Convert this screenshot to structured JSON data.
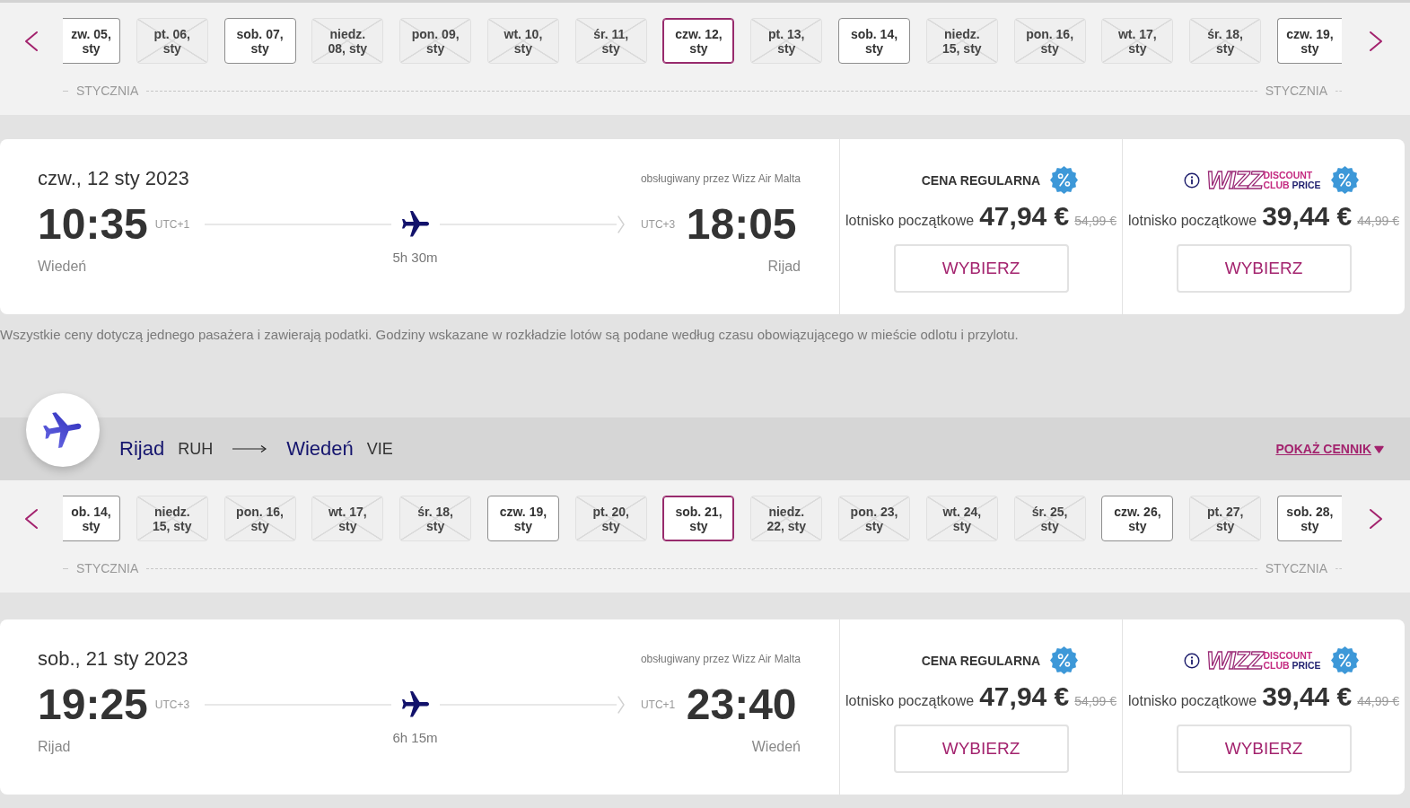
{
  "outbound": {
    "date_strip": {
      "dates": [
        {
          "label": "zw. 05, sty",
          "available": true,
          "selected": false
        },
        {
          "label": "pt. 06, sty",
          "available": false,
          "selected": false
        },
        {
          "label": "sob. 07, sty",
          "available": true,
          "selected": false
        },
        {
          "label": "niedz. 08, sty",
          "available": false,
          "selected": false
        },
        {
          "label": "pon. 09, sty",
          "available": false,
          "selected": false
        },
        {
          "label": "wt. 10, sty",
          "available": false,
          "selected": false
        },
        {
          "label": "śr. 11, sty",
          "available": false,
          "selected": false
        },
        {
          "label": "czw. 12, sty",
          "available": true,
          "selected": true
        },
        {
          "label": "pt. 13, sty",
          "available": false,
          "selected": false
        },
        {
          "label": "sob. 14, sty",
          "available": true,
          "selected": false
        },
        {
          "label": "niedz. 15, sty",
          "available": false,
          "selected": false
        },
        {
          "label": "pon. 16, sty",
          "available": false,
          "selected": false
        },
        {
          "label": "wt. 17, sty",
          "available": false,
          "selected": false
        },
        {
          "label": "śr. 18, sty",
          "available": false,
          "selected": false
        },
        {
          "label": "czw. 19, sty",
          "available": true,
          "selected": false
        }
      ],
      "month_labels": [
        "STYCZNIA",
        "STYCZNIA"
      ]
    },
    "flight": {
      "date": "czw., 12 sty 2023",
      "operator": "obsługiwany przez Wizz Air Malta",
      "departure": {
        "time": "10:35",
        "timezone": "UTC+1",
        "city": "Wiedeń"
      },
      "duration": "5h 30m",
      "arrival": {
        "time": "18:05",
        "timezone": "UTC+3",
        "city": "Rijad"
      },
      "fares": [
        {
          "kind": "regular",
          "title": "CENA REGULARNA",
          "label": "lotnisko początkowe",
          "price": "47,94 €",
          "old_price": "54,99 €",
          "button": "WYBIERZ"
        },
        {
          "kind": "club",
          "logo": {
            "mark": "WIZZ",
            "line_1": "DISCOUNT",
            "line_2": "CLUB",
            "line_2_accent": "PRICE"
          },
          "label": "lotnisko początkowe",
          "price": "39,44 €",
          "old_price": "44,99 €",
          "button": "WYBIERZ"
        }
      ]
    }
  },
  "price_note": "Wszystkie ceny dotyczą jednego pasażera i zawierają podatki. Godziny wskazane w rozkładzie lotów są podane według czasu obowiązującego w mieście odlotu i przylotu.",
  "return": {
    "route": {
      "origin": {
        "city": "Rijad",
        "code": "RUH"
      },
      "destination": {
        "city": "Wiedeń",
        "code": "VIE"
      },
      "link": "POKAŻ CENNIK"
    },
    "date_strip": {
      "dates": [
        {
          "label": "ob. 14, sty",
          "available": true,
          "selected": false
        },
        {
          "label": "niedz. 15, sty",
          "available": false,
          "selected": false
        },
        {
          "label": "pon. 16, sty",
          "available": false,
          "selected": false
        },
        {
          "label": "wt. 17, sty",
          "available": false,
          "selected": false
        },
        {
          "label": "śr. 18, sty",
          "available": false,
          "selected": false
        },
        {
          "label": "czw. 19, sty",
          "available": true,
          "selected": false
        },
        {
          "label": "pt. 20, sty",
          "available": false,
          "selected": false
        },
        {
          "label": "sob. 21, sty",
          "available": true,
          "selected": true
        },
        {
          "label": "niedz. 22, sty",
          "available": false,
          "selected": false
        },
        {
          "label": "pon. 23, sty",
          "available": false,
          "selected": false
        },
        {
          "label": "wt. 24, sty",
          "available": false,
          "selected": false
        },
        {
          "label": "śr. 25, sty",
          "available": false,
          "selected": false
        },
        {
          "label": "czw. 26, sty",
          "available": true,
          "selected": false
        },
        {
          "label": "pt. 27, sty",
          "available": false,
          "selected": false
        },
        {
          "label": "sob. 28, sty",
          "available": true,
          "selected": false
        }
      ],
      "month_labels": [
        "STYCZNIA",
        "STYCZNIA"
      ]
    },
    "flight": {
      "date": "sob., 21 sty 2023",
      "operator": "obsługiwany przez Wizz Air Malta",
      "departure": {
        "time": "19:25",
        "timezone": "UTC+3",
        "city": "Rijad"
      },
      "duration": "6h 15m",
      "arrival": {
        "time": "23:40",
        "timezone": "UTC+1",
        "city": "Wiedeń"
      },
      "fares": [
        {
          "kind": "regular",
          "title": "CENA REGULARNA",
          "label": "lotnisko początkowe",
          "price": "47,94 €",
          "old_price": "54,99 €",
          "button": "WYBIERZ"
        },
        {
          "kind": "club",
          "logo": {
            "mark": "WIZZ",
            "line_1": "DISCOUNT",
            "line_2": "CLUB",
            "line_2_accent": "PRICE"
          },
          "label": "lotnisko początkowe",
          "price": "39,44 €",
          "old_price": "44,99 €",
          "button": "WYBIERZ"
        }
      ]
    }
  }
}
